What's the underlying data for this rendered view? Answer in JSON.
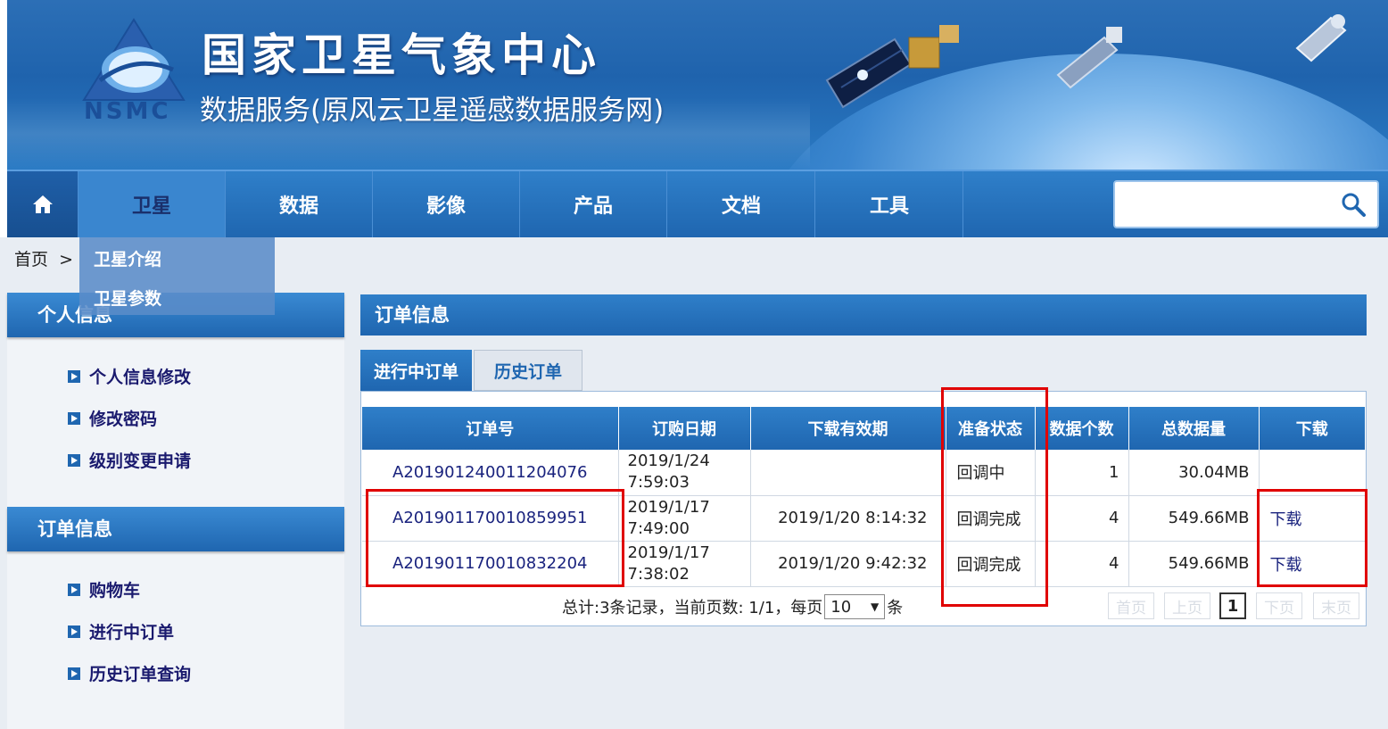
{
  "header": {
    "title": "国家卫星气象中心",
    "subtitle": "数据服务(原风云卫星遥感数据服务网)",
    "logo_text": "NSMC"
  },
  "nav": {
    "items": [
      {
        "label": "卫星"
      },
      {
        "label": "数据"
      },
      {
        "label": "影像"
      },
      {
        "label": "产品"
      },
      {
        "label": "文档"
      },
      {
        "label": "工具"
      }
    ],
    "search_value": ""
  },
  "dropdown": {
    "items": [
      {
        "label": "卫星介绍"
      },
      {
        "label": "卫星参数"
      }
    ]
  },
  "breadcrumb": {
    "home": "首页",
    "separator": ">"
  },
  "sidebar": {
    "sections": [
      {
        "title": "个人信息",
        "links": [
          {
            "label": "个人信息修改"
          },
          {
            "label": "修改密码"
          },
          {
            "label": "级别变更申请"
          }
        ]
      },
      {
        "title": "订单信息",
        "links": [
          {
            "label": "购物车"
          },
          {
            "label": "进行中订单"
          },
          {
            "label": "历史订单查询"
          }
        ]
      }
    ]
  },
  "main": {
    "title": "订单信息",
    "tabs": [
      {
        "label": "进行中订单"
      },
      {
        "label": "历史订单"
      }
    ],
    "table": {
      "headers": [
        "订单号",
        "订购日期",
        "下载有效期",
        "准备状态",
        "数据个数",
        "总数据量",
        "下载"
      ],
      "rows": [
        {
          "order": "A201901240011204076",
          "date": "2019/1/24",
          "time": "7:59:03",
          "valid": "",
          "status": "回调中",
          "count": "1",
          "size": "30.04MB",
          "download": ""
        },
        {
          "order": "A201901170010859951",
          "date": "2019/1/17",
          "time": "7:49:00",
          "valid": "2019/1/20 8:14:32",
          "status": "回调完成",
          "count": "4",
          "size": "549.66MB",
          "download": "下载"
        },
        {
          "order": "A201901170010832204",
          "date": "2019/1/17",
          "time": "7:38:02",
          "valid": "2019/1/20 9:42:32",
          "status": "回调完成",
          "count": "4",
          "size": "549.66MB",
          "download": "下载"
        }
      ]
    },
    "pager": {
      "summary": "总计:3条记录，当前页数: 1/1，每页",
      "per_page": "10",
      "unit": "条",
      "first": "首页",
      "prev": "上页",
      "current": "1",
      "next": "下页",
      "last": "末页"
    }
  },
  "colors": {
    "nav_blue": "#1f66b0",
    "highlight_red": "#e00000",
    "link_navy": "#1a237e"
  }
}
